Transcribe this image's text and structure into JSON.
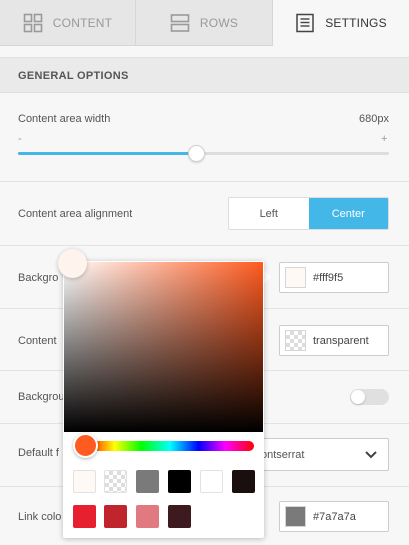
{
  "tabs": [
    {
      "label": "CONTENT",
      "icon": "grid-icon"
    },
    {
      "label": "ROWS",
      "icon": "rows-icon"
    },
    {
      "label": "SETTINGS",
      "icon": "document-icon"
    }
  ],
  "section_title": "GENERAL OPTIONS",
  "content_width": {
    "label": "Content area width",
    "value": "680px",
    "min_symbol": "-",
    "max_symbol": "+",
    "fraction": 0.48
  },
  "alignment": {
    "label": "Content area alignment",
    "options": [
      "Left",
      "Center"
    ],
    "selected": "Center"
  },
  "background_color": {
    "label": "Backgro",
    "value": "#fff9f5"
  },
  "content_bg": {
    "label": "Content",
    "value": "transparent"
  },
  "background_toggle": {
    "label": "Backgrou",
    "on": false
  },
  "default_font": {
    "label": "Default f",
    "value": "ontserrat"
  },
  "link_color": {
    "label": "Link colo",
    "value": "#7a7a7a"
  },
  "picker": {
    "hue_color": "#ff5a1f",
    "selected_color": "#fff3ed",
    "presets": [
      "#fff9f5",
      "transparent",
      "#7a7a7a",
      "#000000",
      "#ffffff",
      "#1a0e0e",
      "#e6202f",
      "#c0242c",
      "#e07a80",
      "#3d1a1e"
    ]
  },
  "colors": {
    "accent": "#42b7e8"
  }
}
